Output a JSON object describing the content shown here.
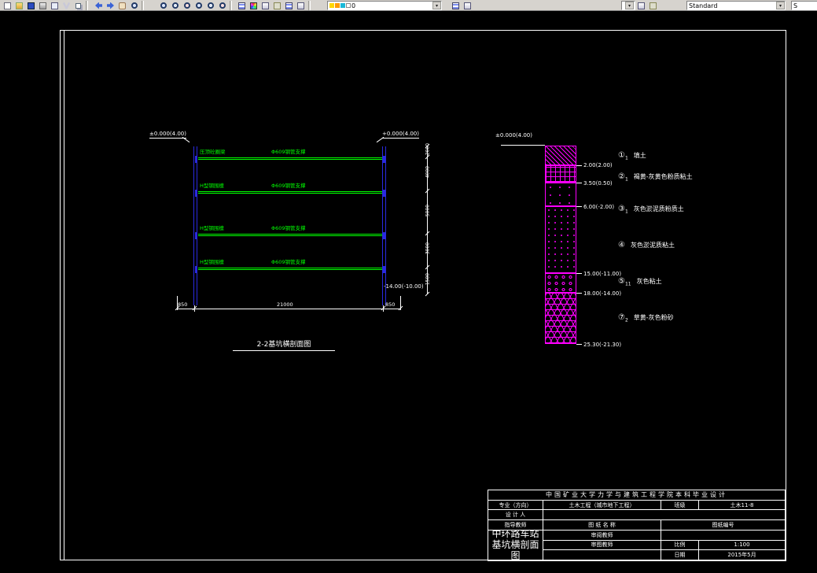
{
  "toolbar": {
    "layer_combo": {
      "value": "0"
    },
    "style_combo": {
      "value": "Standard"
    },
    "text_style_combo": {
      "value": "S"
    },
    "dropdown_glyph": "▾"
  },
  "drawing": {
    "section": {
      "title": "2-2基坑横剖面图",
      "elev_top_left": "±0.000(4.00)",
      "elev_top_right": "+0.000(4.00)",
      "elev_bottom_right": "-14.00(-10.00)",
      "struts": [
        {
          "member_label": "压顶砼圈梁",
          "strut_label": "Φ609钢管支撑"
        },
        {
          "member_label": "H型钢围檩",
          "strut_label": "Φ609钢管支撑"
        },
        {
          "member_label": "H型钢围檩",
          "strut_label": "Φ609钢管支撑"
        },
        {
          "member_label": "H型钢围檩",
          "strut_label": "Φ609钢管支撑"
        }
      ],
      "right_dims": [
        "2000",
        "4000",
        "5000",
        "3000",
        "1500"
      ],
      "bottom_dims": [
        "850",
        "21000",
        "850"
      ]
    },
    "borehole": {
      "top_elev": "±0.000(4.00)",
      "layers": [
        {
          "depth_bottom": "2.00(2.00)",
          "code": "①",
          "sub": "1",
          "name": "填土"
        },
        {
          "depth_bottom": "3.50(0.50)",
          "code": "②",
          "sub": "1",
          "name": "褐黄-灰黄色粉质粘土"
        },
        {
          "depth_bottom": "6.00(-2.00)",
          "code": "③",
          "sub": "1",
          "name": "灰色淤泥质粉质土"
        },
        {
          "depth_bottom": "15.00(-11.00)",
          "code": "④",
          "sub": "",
          "name": "灰色淤泥质粘土"
        },
        {
          "depth_bottom": "18.00(-14.00)",
          "code": "⑤",
          "sub": "11",
          "name": "灰色粘土"
        },
        {
          "depth_bottom": "25.30(-21.30)",
          "code": "⑦",
          "sub": "2",
          "name": "草黄-灰色粉砂"
        }
      ]
    },
    "titleblock": {
      "header": "中国矿业大学力学与建筑工程学院本科毕业设计",
      "major_label": "专业（方向）",
      "major_value": "土木工程（城市地下工程）",
      "class_label": "班级",
      "class_value": "土木11-8",
      "designer_label": "设 计 人",
      "advisor_label": "指导教师",
      "reviewer_label": "审阅教师",
      "approver_label": "审图教师",
      "name_header": "图 纸 名 称",
      "number_label": "图纸编号",
      "drawing_name": "中环路车站基坑横剖面图",
      "scale_label": "比例",
      "scale_value": "1:100",
      "date_label": "日期",
      "date_value": "2015年5月"
    }
  },
  "colors": {
    "canvas_bg": "#000000",
    "frame": "#ffffff",
    "struts_green": "#00ff00",
    "walls_blue": "#2a2ae0",
    "soil_magenta": "#ff00ff",
    "toolbar_bg": "#d6d3ce"
  }
}
